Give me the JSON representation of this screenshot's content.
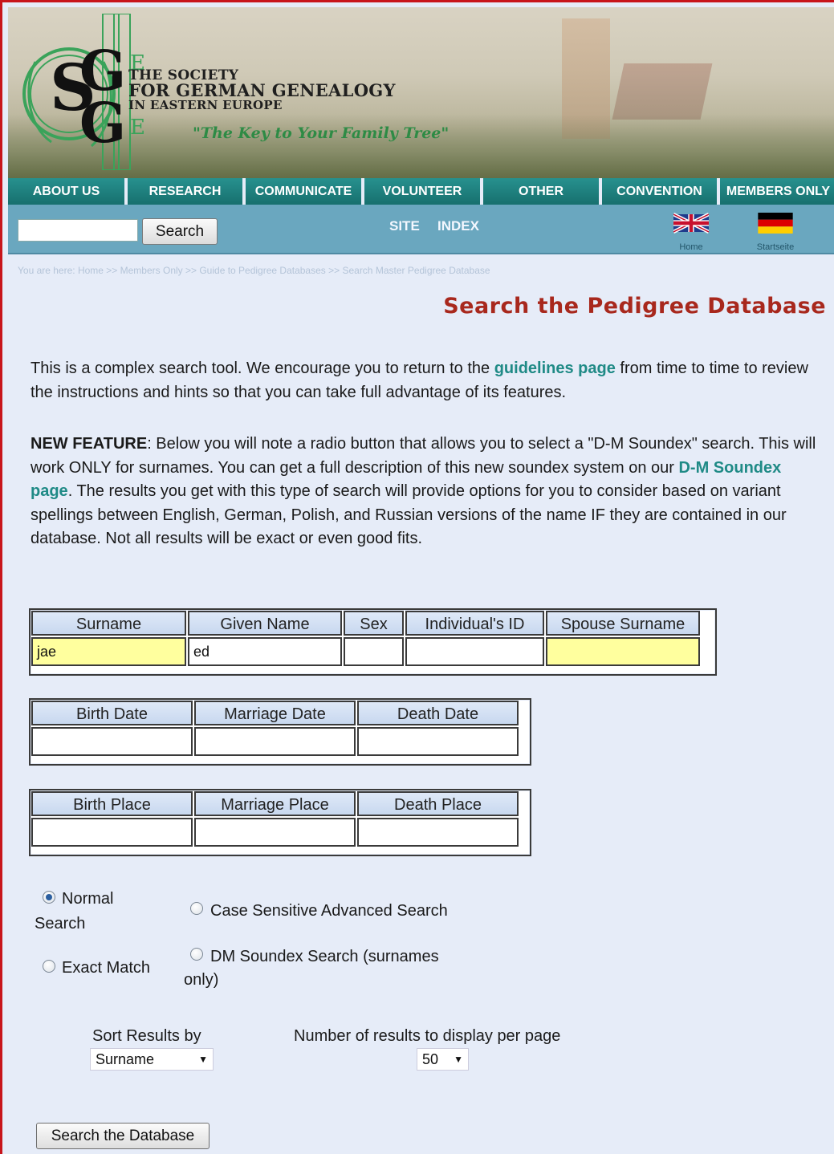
{
  "header": {
    "logo_letters": "SGGEE",
    "society_line1": "THE SOCIETY",
    "society_line2": "FOR GERMAN GENEALOGY",
    "society_line3": "IN EASTERN EUROPE",
    "tagline": "\"The Key to Your Family Tree\""
  },
  "nav": {
    "items": [
      {
        "label": "ABOUT US"
      },
      {
        "label": "RESEARCH"
      },
      {
        "label": "COMMUNICATE"
      },
      {
        "label": "VOLUNTEER"
      },
      {
        "label": "OTHER"
      },
      {
        "label": "CONVENTION"
      },
      {
        "label": "MEMBERS ONLY"
      }
    ]
  },
  "subbar": {
    "search_value": "",
    "search_button": "Search",
    "site_label": "SITE",
    "index_label": "INDEX",
    "home_caption": "Home",
    "startseite_caption": "Startseite"
  },
  "breadcrumb": "You are here:  Home >> Members Only >> Guide to Pedigree Databases >> Search Master Pedigree Database",
  "title": "Search the Pedigree Database",
  "intro": {
    "text_before": "This is a complex search tool. We encourage you to return to the ",
    "link": "guidelines page",
    "text_after": " from time to time to review the instructions and hints so that you can take full advantage of its features."
  },
  "feature": {
    "label": "NEW FEATURE",
    "text_before": ": Below you will note a radio button that allows you to select a \"D-M Soundex\" search. This will work ONLY for surnames. You can get a full description of this new soundex system on our ",
    "link": "D-M Soundex page",
    "text_after": ". The results you get with this type of search will provide options for you to consider based on variant spellings between English, German, Polish, and Russian versions of the name IF they are contained in our database. Not all results will be exact or even good fits."
  },
  "name_table": {
    "headers": [
      "Surname",
      "Given Name",
      "Sex",
      "Individual's ID",
      "Spouse Surname"
    ],
    "values": [
      "jae",
      "ed",
      "",
      "",
      ""
    ]
  },
  "date_table": {
    "headers": [
      "Birth Date",
      "Marriage Date",
      "Death Date"
    ],
    "values": [
      "",
      "",
      ""
    ]
  },
  "place_table": {
    "headers": [
      "Birth Place",
      "Marriage Place",
      "Death Place"
    ],
    "values": [
      "",
      "",
      ""
    ]
  },
  "options": {
    "normal_line1": "Normal",
    "normal_line2": "Search",
    "case_sensitive": "Case Sensitive Advanced Search",
    "exact_match": "Exact Match",
    "dm_line1": "DM Soundex Search (surnames",
    "dm_line2": "only)",
    "selected": "Normal Search"
  },
  "sort": {
    "label": "Sort Results by",
    "value": "Surname"
  },
  "per_page": {
    "label": "Number of results to display per page",
    "value": "50"
  },
  "submit_label": "Search the Database",
  "colors": {
    "nav": "#1e7a78",
    "subbar": "#6aa7bf",
    "title": "#a8281d",
    "link": "#1f8a86",
    "highlight_field": "#ffff9e",
    "frame": "#c8151b"
  }
}
